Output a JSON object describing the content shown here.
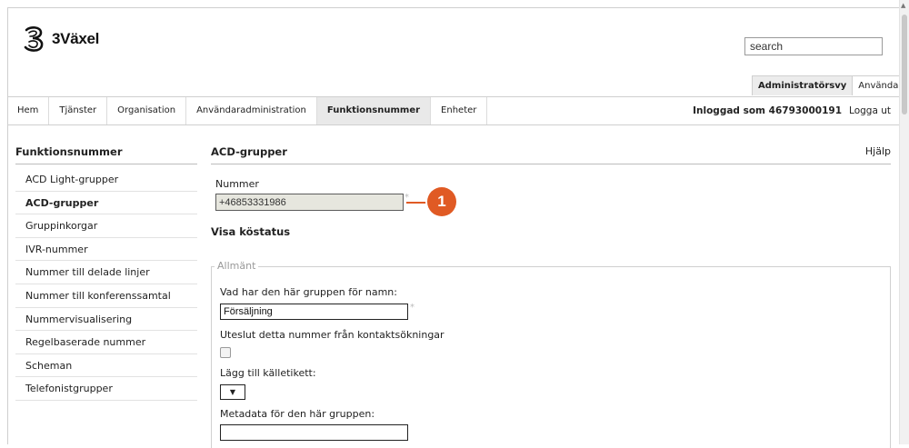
{
  "brand": {
    "name": "3Växel",
    "logo_icon": "three-logo-icon"
  },
  "search": {
    "value": "search"
  },
  "view_tabs": [
    {
      "label": "Administratörsvy",
      "active": true
    },
    {
      "label": "Användarvy",
      "active": false
    }
  ],
  "nav": {
    "items": [
      {
        "label": "Hem"
      },
      {
        "label": "Tjänster"
      },
      {
        "label": "Organisation"
      },
      {
        "label": "Användaradministration"
      },
      {
        "label": "Funktionsnummer",
        "active": true
      },
      {
        "label": "Enheter"
      }
    ],
    "logged_in": "Inloggad som 46793000191",
    "logout": "Logga ut"
  },
  "sidebar": {
    "title": "Funktionsnummer",
    "items": [
      {
        "label": "ACD Light-grupper"
      },
      {
        "label": "ACD-grupper",
        "active": true
      },
      {
        "label": "Gruppinkorgar"
      },
      {
        "label": "IVR-nummer"
      },
      {
        "label": "Nummer till delade linjer"
      },
      {
        "label": "Nummer till konferenssamtal"
      },
      {
        "label": "Nummervisualisering"
      },
      {
        "label": "Regelbaserade nummer"
      },
      {
        "label": "Scheman"
      },
      {
        "label": "Telefonistgrupper"
      }
    ]
  },
  "main": {
    "title": "ACD-grupper",
    "help": "Hjälp",
    "number_label": "Nummer",
    "number_value": "+46853331986",
    "required_mark": "*",
    "callout": "1",
    "queue_status": "Visa köstatus",
    "section_legend": "Allmänt",
    "name_label": "Vad har den här gruppen för namn:",
    "name_value": "Försäljning",
    "exclude_label": "Uteslut detta nummer från kontaktsökningar",
    "exclude_checked": false,
    "source_label": "Lägg till källetikett:",
    "source_select_glyph": "▼",
    "metadata_label": "Metadata för den här gruppen:",
    "metadata_value": ""
  },
  "colors": {
    "accent": "#e05a24",
    "active_tab": "#e9e9e9",
    "border": "#cfcfcf"
  }
}
